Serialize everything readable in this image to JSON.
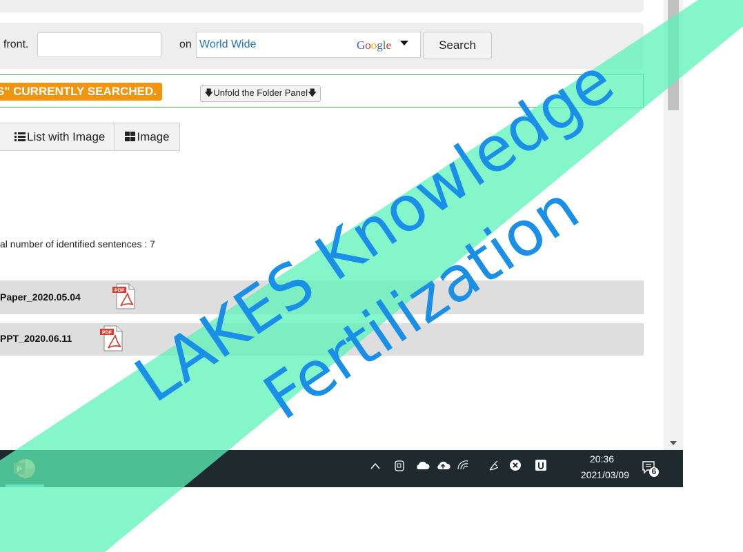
{
  "search": {
    "front_text": "front.",
    "query_value": "",
    "on_text": "on",
    "scope": "World Wide",
    "engine_logo": "Google",
    "search_button": "Search"
  },
  "status": {
    "badge_text": "S\" CURRENTLY SEARCHED.",
    "unfold_label": "Unfold the Folder Panel"
  },
  "view_options": {
    "list_with_image": "List with Image",
    "image": "Image"
  },
  "results": {
    "count_text": "al number of identified sentences : 7",
    "items": [
      {
        "title": "Paper_2020.05.04",
        "file_icon": "pdf-icon"
      },
      {
        "title": "PPT_2020.06.11",
        "file_icon": "pdf-icon"
      }
    ]
  },
  "watermark": {
    "line1": "LAKES Knowledge",
    "line2": "Fertilization",
    "band_color": "#5cf2b8",
    "text_color": "#1a8fe8"
  },
  "taskbar": {
    "app_icon": "powerpoint-icon",
    "time": "20:36",
    "date": "2021/03/09",
    "notification_count": "6"
  },
  "colors": {
    "accent_orange": "#f0960e",
    "status_border": "#4caf50",
    "link_blue": "#1e73be",
    "taskbar_bg": "#1f2a2e"
  }
}
